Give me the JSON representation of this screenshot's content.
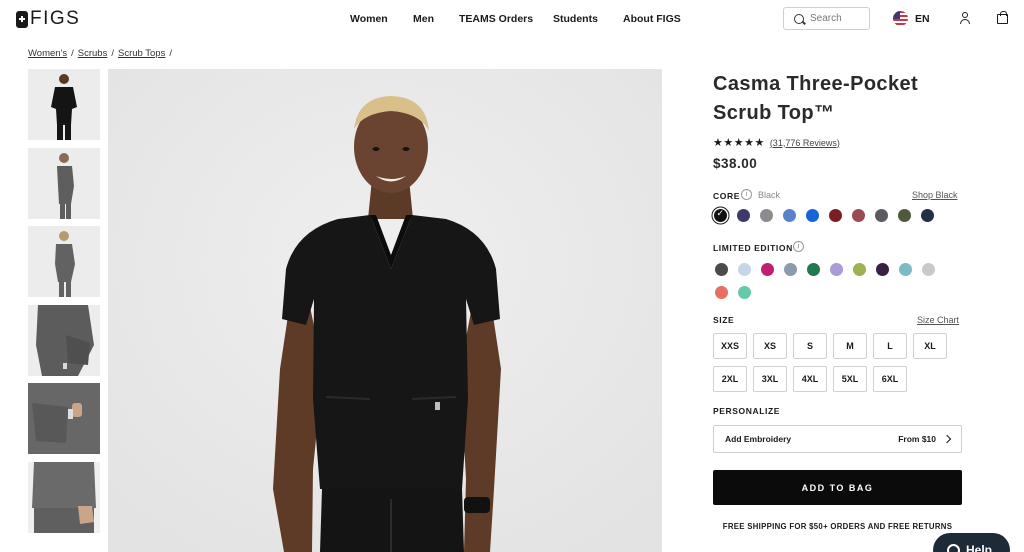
{
  "header": {
    "logo_text": "FIGS",
    "nav": [
      "Women",
      "Men",
      "TEAMS Orders",
      "Students",
      "About FIGS"
    ],
    "search_placeholder": "Search",
    "language": "EN"
  },
  "breadcrumb": [
    "Women's",
    "Scrubs",
    "Scrub Tops"
  ],
  "product": {
    "title": "Casma Three-Pocket Scrub Top™",
    "stars": "★★★★★",
    "rating": 4.5,
    "reviews_label": "(31,776 Reviews)",
    "price": "$38.00"
  },
  "core": {
    "label": "CORE",
    "selected_color": "Black",
    "shop_link": "Shop Black",
    "colors": [
      "#111111",
      "#3d3a6b",
      "#8c8c90",
      "#5a82c9",
      "#1565d8",
      "#7a1f24",
      "#9a4a52",
      "#5c5c60",
      "#4f5a3c",
      "#233048"
    ]
  },
  "limited": {
    "label": "LIMITED EDITION",
    "colors": [
      "#4b4b4b",
      "#c7d5ea",
      "#c0206f",
      "#8a9bb0",
      "#1f7a52",
      "#a89bd6",
      "#9eb153",
      "#3a1f45",
      "#7bbcc4",
      "#c9c9c9",
      "#e86f62",
      "#66c9a8"
    ]
  },
  "size": {
    "label": "SIZE",
    "chart_link": "Size Chart",
    "options": [
      "XXS",
      "XS",
      "S",
      "M",
      "L",
      "XL",
      "2XL",
      "3XL",
      "4XL",
      "5XL",
      "6XL"
    ]
  },
  "personalize": {
    "label": "PERSONALIZE",
    "embroidery_label": "Add Embroidery",
    "embroidery_price": "From $10"
  },
  "add_to_bag": "ADD TO BAG",
  "shipping_note": "FREE SHIPPING FOR $50+ ORDERS AND FREE RETURNS",
  "help_label": "Help"
}
